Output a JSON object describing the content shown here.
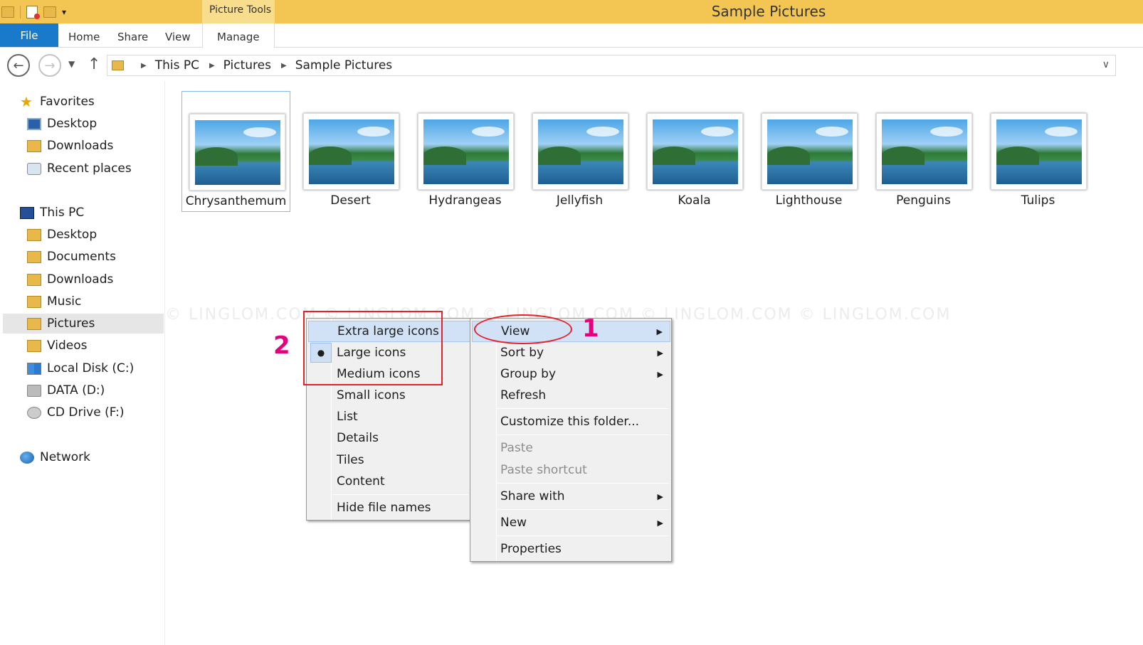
{
  "window": {
    "title": "Sample Pictures",
    "context_tab": "Picture Tools"
  },
  "ribbon": {
    "file": "File",
    "tabs": [
      "Home",
      "Share",
      "View",
      "Manage"
    ]
  },
  "address": {
    "path": [
      "This PC",
      "Pictures",
      "Sample Pictures"
    ]
  },
  "nav": {
    "favorites": {
      "label": "Favorites",
      "items": [
        "Desktop",
        "Downloads",
        "Recent places"
      ]
    },
    "this_pc": {
      "label": "This PC",
      "items": [
        "Desktop",
        "Documents",
        "Downloads",
        "Music",
        "Pictures",
        "Videos",
        "Local Disk (C:)",
        "DATA (D:)",
        "CD Drive (F:)"
      ]
    },
    "network": "Network",
    "selected": "Pictures"
  },
  "files": [
    "Chrysanthemum",
    "Desert",
    "Hydrangeas",
    "Jellyfish",
    "Koala",
    "Lighthouse",
    "Penguins",
    "Tulips"
  ],
  "watermark": "© LINGLOM.COM      © LINGLOM.COM      © LINGLOM.COM      © LINGLOM.COM      © LINGLOM.COM",
  "context_menu": {
    "items": [
      "View",
      "Sort by",
      "Group by",
      "Refresh",
      "Customize this folder...",
      "Paste",
      "Paste shortcut",
      "Share with",
      "New",
      "Properties"
    ],
    "disabled": [
      "Paste",
      "Paste shortcut"
    ],
    "highlighted": "View"
  },
  "view_submenu": {
    "items": [
      "Extra large icons",
      "Large icons",
      "Medium icons",
      "Small icons",
      "List",
      "Details",
      "Tiles",
      "Content",
      "Hide file names"
    ],
    "highlighted": "Extra large icons",
    "checked": "Large icons"
  },
  "annotations": {
    "step1": "1",
    "step2": "2",
    "color": "#e6007e",
    "box_color": "#e8202a"
  }
}
